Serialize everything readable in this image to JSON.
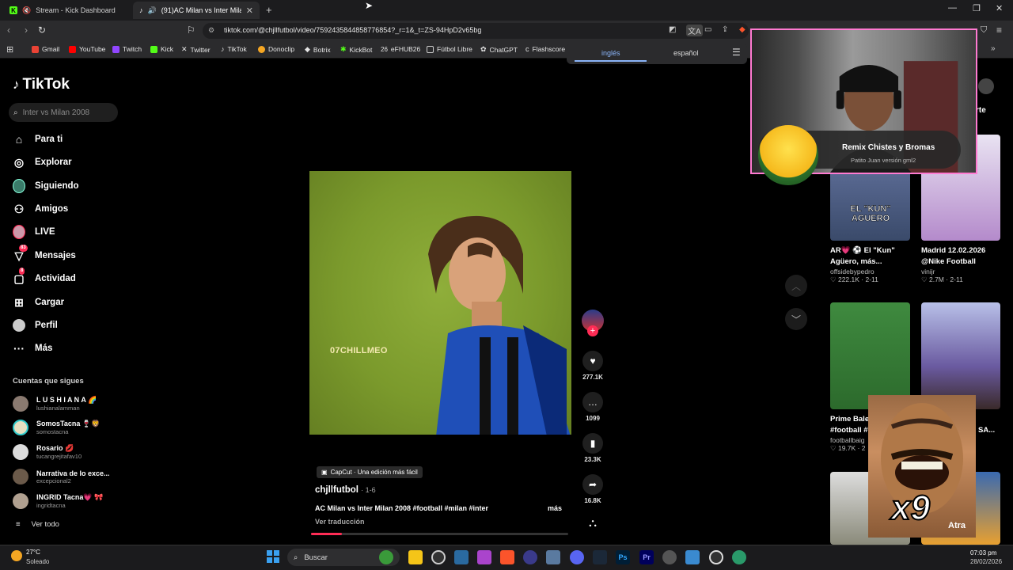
{
  "tabs": [
    {
      "label": "Stream - Kick Dashboard"
    },
    {
      "label": "(91)AC Milan vs Inter Milan 2(…"
    }
  ],
  "address": {
    "url": "tiktok.com/@chjllfutbol/video/7592435844858776854?_r=1&_t=ZS-94HpD2v65bg"
  },
  "bookmarks": [
    {
      "label": "Gmail",
      "color": "#ea4335"
    },
    {
      "label": "YouTube",
      "color": "#ff0000"
    },
    {
      "label": "Twitch",
      "color": "#9146ff"
    },
    {
      "label": "Kick",
      "color": "#53fc18"
    },
    {
      "label": "Twitter",
      "color": "#ffffff"
    },
    {
      "label": "TikTok",
      "color": "#ffffff"
    },
    {
      "label": "Donoclip",
      "color": "#f5a623"
    },
    {
      "label": "Botrix",
      "color": "#dddddd"
    },
    {
      "label": "KickBot",
      "color": "#53fc18"
    },
    {
      "label": "eFHUB26",
      "color": "#cccccc"
    },
    {
      "label": "Fútbol Libre",
      "color": "#cccccc"
    },
    {
      "label": "ChatGPT",
      "color": "#cccccc"
    },
    {
      "label": "Flashscore",
      "color": "#cccccc"
    }
  ],
  "translate": {
    "lang1": "inglés",
    "lang2": "español"
  },
  "sidebar": {
    "logo": "TikTok",
    "search_placeholder": "Inter vs Milan 2008",
    "nav": [
      {
        "label": "Para ti",
        "icon": "home-icon"
      },
      {
        "label": "Explorar",
        "icon": "compass-icon"
      },
      {
        "label": "Siguiendo",
        "icon": "following-avatar-icon"
      },
      {
        "label": "Amigos",
        "icon": "friends-icon"
      },
      {
        "label": "LIVE",
        "icon": "live-icon"
      },
      {
        "label": "Mensajes",
        "icon": "messages-icon",
        "badge": "83"
      },
      {
        "label": "Actividad",
        "icon": "activity-icon",
        "badge": "8"
      },
      {
        "label": "Cargar",
        "icon": "upload-icon"
      },
      {
        "label": "Perfil",
        "icon": "profile-icon"
      },
      {
        "label": "Más",
        "icon": "more-icon"
      }
    ],
    "following_title": "Cuentas que sigues",
    "accounts": [
      {
        "name": "L U S H I A N A 🌈",
        "handle": "lushianalamman",
        "color": "#8a7a70"
      },
      {
        "name": "SomosTacna 🍷🦁",
        "handle": "somostacna",
        "color": "#e8e0c0"
      },
      {
        "name": "Rosario 💋",
        "handle": "tucangrejitafav10",
        "color": "#dcdcdc"
      },
      {
        "name": "Narrativa de lo exce...",
        "handle": "excepcional2",
        "color": "#6b5a4a"
      },
      {
        "name": "INGRID Tacna💗 🎀",
        "handle": "ingridtacna",
        "color": "#b0a090"
      }
    ],
    "see_all": "Ver todo"
  },
  "video": {
    "watermark": "07CHILLMEO",
    "capcut": "CapCut · Una edición más fácil",
    "author": "chjllfutbol",
    "date": "· 1-6",
    "caption": "AC Milan vs Inter Milan 2008 #football #milan #inter",
    "more": "más",
    "see_translation": "Ver traducción",
    "progress": 0.12,
    "likes": "277.1K",
    "comments": "1099",
    "saves": "23.3K",
    "shares": "16.8K"
  },
  "feed": [
    {
      "title1": "AR💗 ⚽ El \"Kun\"",
      "title2": "Agüero, más...",
      "author": "offsidebypedro",
      "stats": "♡ 222.1K · 2-11",
      "thumb_text": "EL \"KUN\" AGUERO"
    },
    {
      "title1": "Madrid 12.02.2026",
      "title2": "@Nike Football",
      "author": "vinijr",
      "stats": "♡ 2.7M · 2-11"
    },
    {
      "title1": "Prime Bale",
      "title2": "#football #",
      "author": "footballbaig",
      "stats": "♡ 19.7K · 2"
    },
    {
      "title1": "",
      "title2": "SA...",
      "author": "",
      "stats": ""
    }
  ],
  "feed_header": "rte",
  "overlay": {
    "remix_title": "Remix Chistes y Bromas",
    "remix_sub": "Patito Juan versión gml2",
    "meme_text": "x9",
    "meme_caption": "Atra"
  },
  "taskbar": {
    "weather_temp": "27°C",
    "weather_desc": "Soleado",
    "search": "Buscar",
    "time": "07:03 pm",
    "date": "28/02/2026"
  }
}
